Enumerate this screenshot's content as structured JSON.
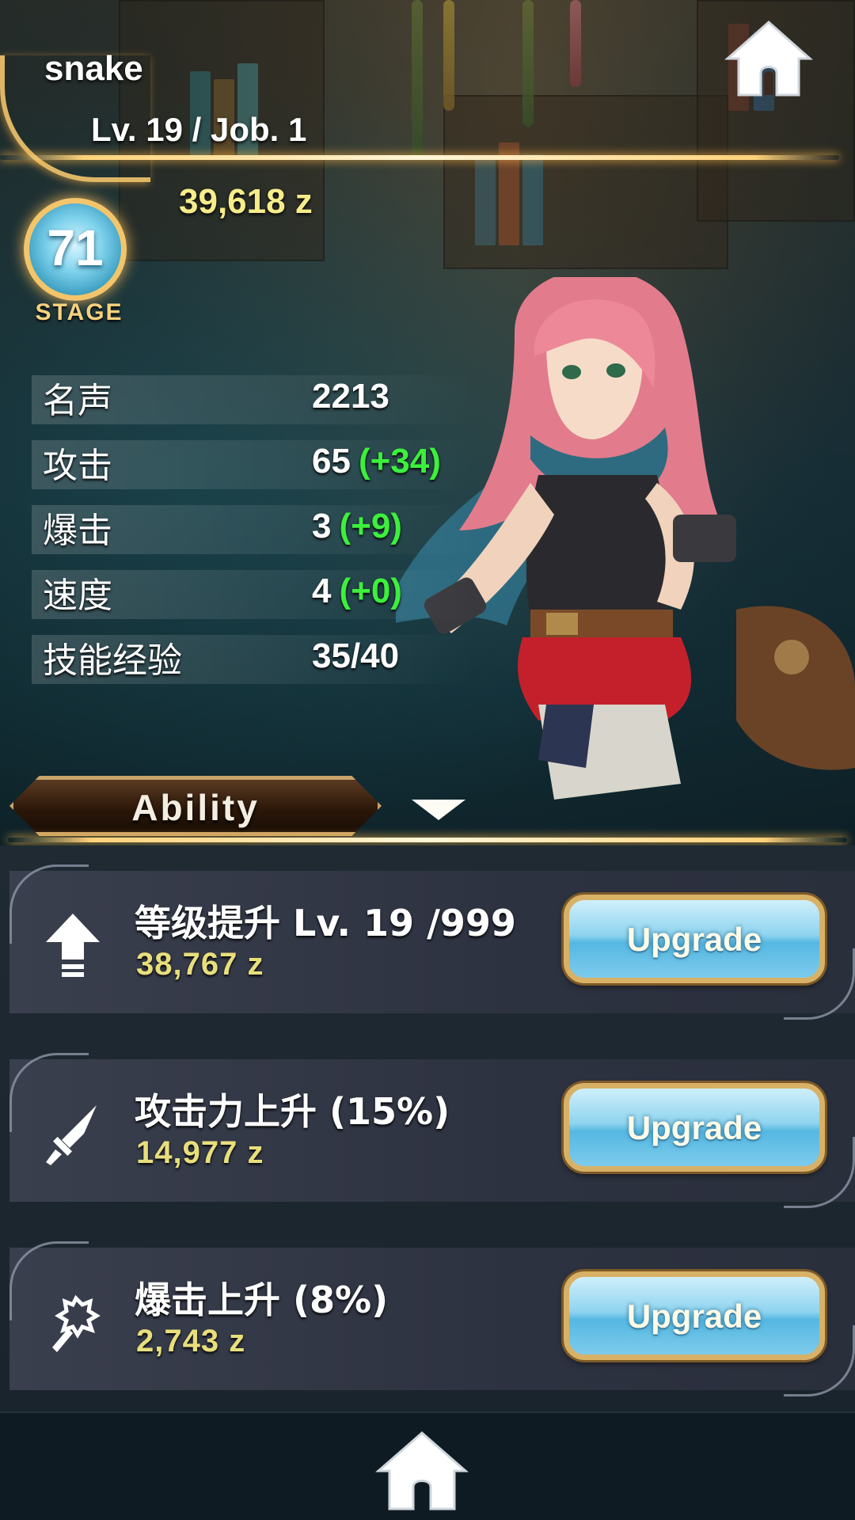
{
  "player": {
    "name": "snake",
    "level_text": "Lv. 19 / Job. 1",
    "zeny": "39,618 z"
  },
  "stage": {
    "number": "71",
    "label": "STAGE"
  },
  "stats": [
    {
      "label": "名声",
      "value": "2213",
      "bonus": ""
    },
    {
      "label": "攻击",
      "value": "65",
      "bonus": "(+34)"
    },
    {
      "label": "爆击",
      "value": "3",
      "bonus": "(+9)"
    },
    {
      "label": "速度",
      "value": "4",
      "bonus": "(+0)"
    },
    {
      "label": "技能经验",
      "value": "35/40",
      "bonus": ""
    }
  ],
  "tab": {
    "label": "Ability"
  },
  "upgrades": [
    {
      "icon": "arrow-up-icon",
      "title": "等级提升 Lv. 19 /999",
      "cost": "38,767 z",
      "button": "Upgrade"
    },
    {
      "icon": "sword-icon",
      "title": "攻击力上升 (15%)",
      "cost": "14,977 z",
      "button": "Upgrade"
    },
    {
      "icon": "crit-hit-icon",
      "title": "爆击上升 (8%)",
      "cost": "2,743 z",
      "button": "Upgrade"
    }
  ],
  "colors": {
    "bonus_green": "#3cf03c",
    "zeny_yellow": "#e8df7c",
    "gold_trim": "#ffd27a",
    "button_blue": "#7dcbec"
  }
}
